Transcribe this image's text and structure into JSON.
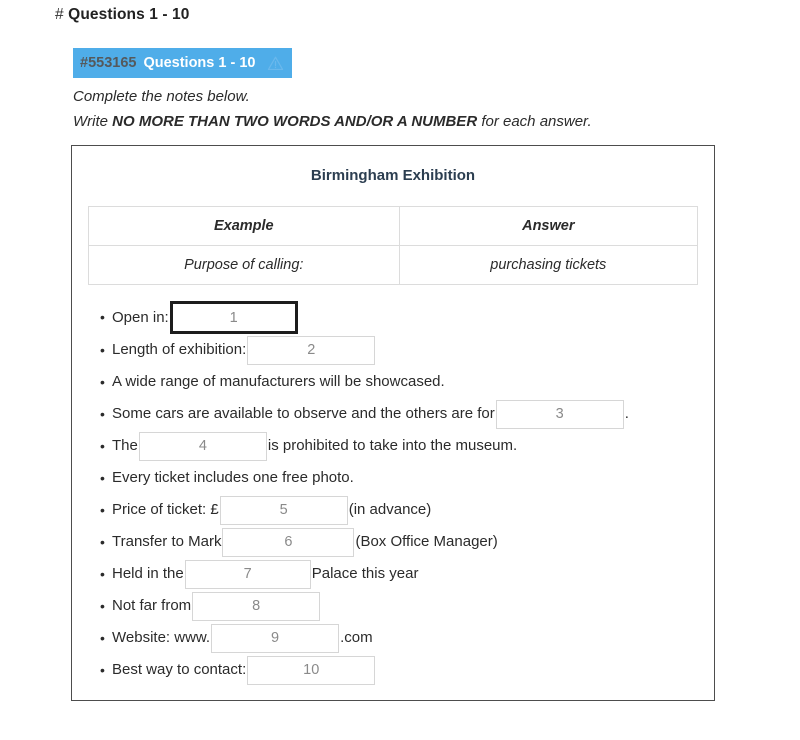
{
  "page": {
    "heading_hash": "#",
    "heading": "Questions 1 - 10"
  },
  "badge": {
    "id": "#553165",
    "title": "Questions 1 - 10",
    "warning_icon": "warning-triangle-icon",
    "background_color": "#4fade9",
    "id_color": "#55595c",
    "title_color": "#ffffff"
  },
  "instructions": {
    "line1": "Complete the notes below.",
    "line2_prefix": "Write ",
    "line2_strong": "NO MORE THAN TWO WORDS AND/OR A NUMBER",
    "line2_suffix": " for each answer."
  },
  "note_box": {
    "title": "Birmingham Exhibition",
    "table": {
      "headers": [
        "Example",
        "Answer"
      ],
      "rows": [
        [
          "Purpose of calling:",
          "purchasing tickets"
        ]
      ]
    },
    "items": [
      {
        "before": "Open in:",
        "input": "1",
        "after": "",
        "focused": true
      },
      {
        "before": "Length of exhibition:",
        "input": "2",
        "after": "",
        "focused": false
      },
      {
        "before": "A wide range of manufacturers will be showcased.",
        "input": null,
        "after": "",
        "focused": false
      },
      {
        "before": "Some cars are available to observe and the others are for",
        "input": "3",
        "after": ".",
        "focused": false
      },
      {
        "before": "The",
        "input": "4",
        "after": "is prohibited to take into the museum.",
        "focused": false
      },
      {
        "before": "Every ticket includes one free photo.",
        "input": null,
        "after": "",
        "focused": false
      },
      {
        "before": "Price of ticket: £",
        "input": "5",
        "after": "(in advance)",
        "focused": false
      },
      {
        "before": "Transfer to Mark",
        "input": "6",
        "after": "(Box Office Manager)",
        "focused": false
      },
      {
        "before": "Held in the",
        "input": "7",
        "after": "Palace this year",
        "focused": false
      },
      {
        "before": "Not far from",
        "input": "8",
        "after": "",
        "focused": false
      },
      {
        "before": "Website: www.",
        "input": "9",
        "after": ".com",
        "focused": false
      },
      {
        "before": "Best way to contact:",
        "input": "10",
        "after": "",
        "focused": false
      }
    ]
  }
}
